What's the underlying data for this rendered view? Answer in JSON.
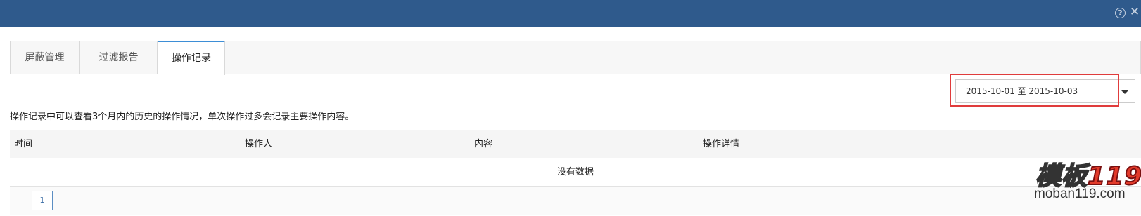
{
  "titlebar": {
    "help_icon": "question-circle-icon",
    "close_icon": "close-icon"
  },
  "tabs": [
    {
      "label": "屏蔽管理"
    },
    {
      "label": "过滤报告"
    },
    {
      "label": "操作记录",
      "active": true
    }
  ],
  "date_range": {
    "value": "2015-10-01 至 2015-10-03",
    "caret_icon": "caret-down-icon",
    "highlight_color": "#e03c3c"
  },
  "note": "操作记录中可以查看3个月内的历史的操作情况，单次操作过多会记录主要操作内容。",
  "table": {
    "columns": [
      "时间",
      "操作人",
      "内容",
      "操作详情"
    ],
    "empty_text": "没有数据"
  },
  "pagination": {
    "current_page": "1"
  },
  "watermark": {
    "logo_text": "模板",
    "logo_number": "119",
    "url": "moban119.com"
  },
  "colors": {
    "titlebar": "#2f5a8c",
    "active_tab_accent": "#3d8ed6"
  }
}
